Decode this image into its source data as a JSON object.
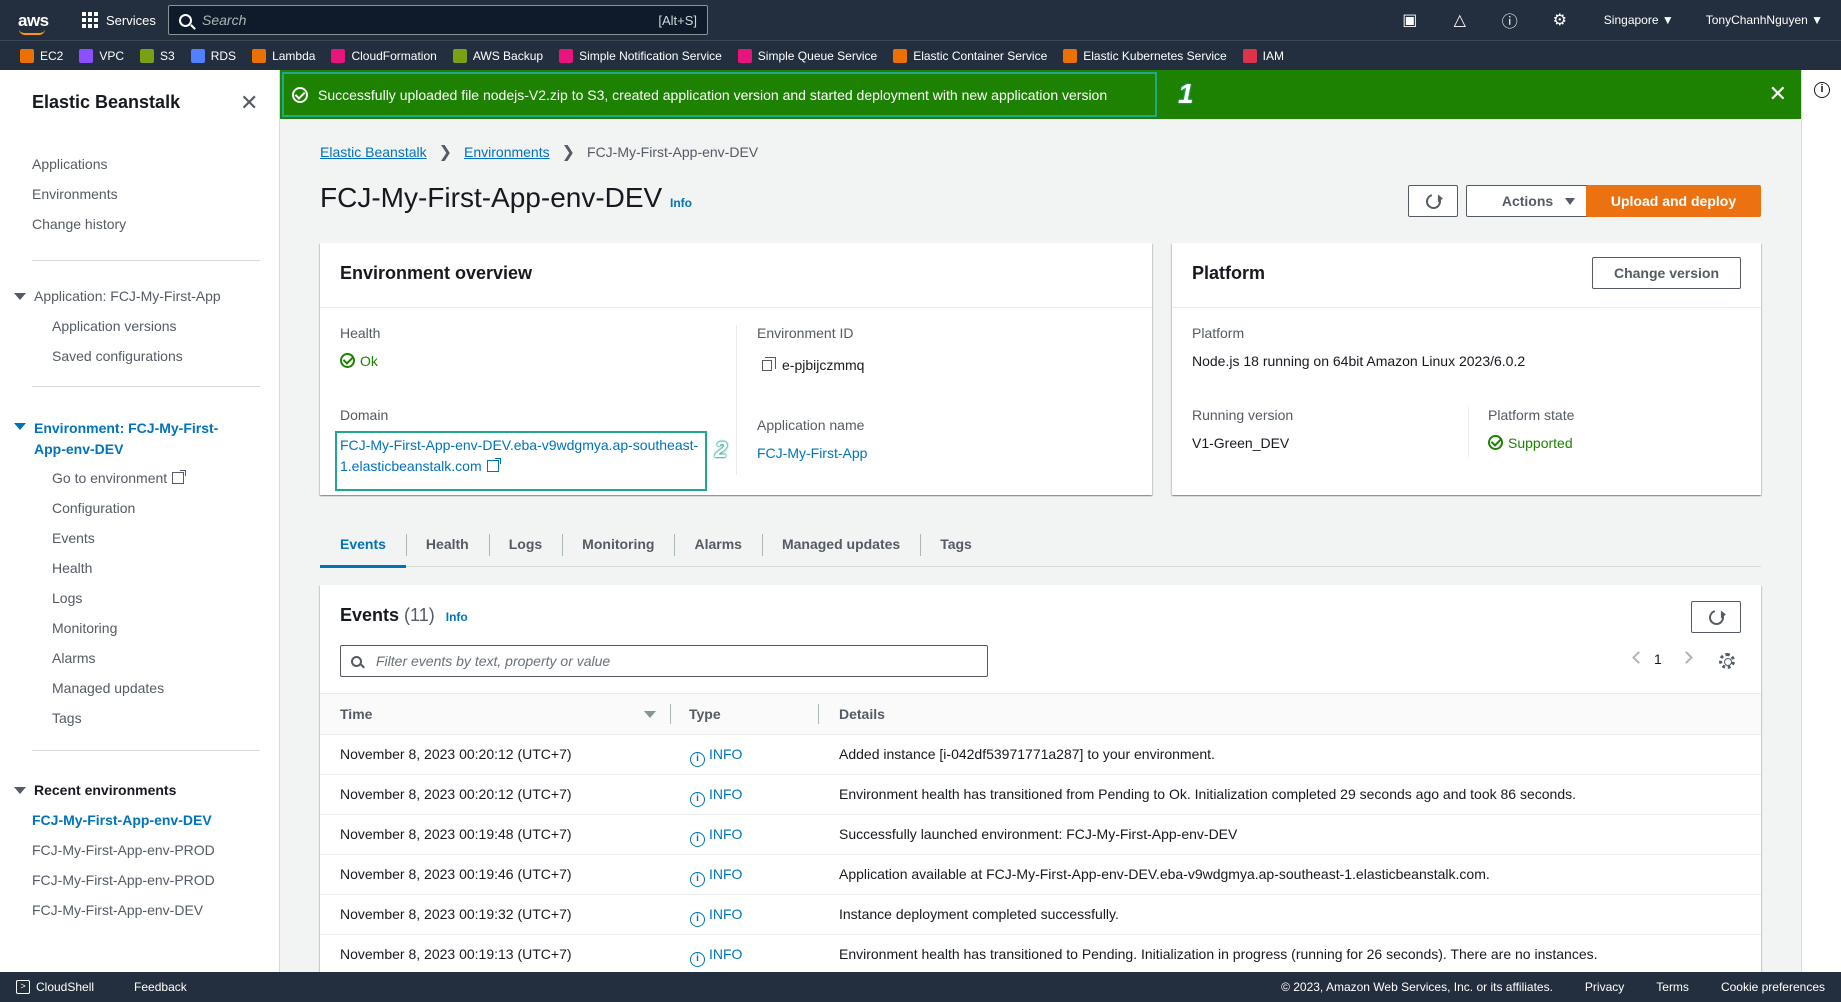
{
  "topnav": {
    "services_label": "Services",
    "search_placeholder": "Search",
    "search_shortcut": "[Alt+S]",
    "region": "Singapore ▼",
    "user": "TonyChanhNguyen ▼"
  },
  "favorites": [
    {
      "label": "EC2",
      "color": "#ed7100"
    },
    {
      "label": "VPC",
      "color": "#8c4fff"
    },
    {
      "label": "S3",
      "color": "#7aa116"
    },
    {
      "label": "RDS",
      "color": "#527fff"
    },
    {
      "label": "Lambda",
      "color": "#ed7100"
    },
    {
      "label": "CloudFormation",
      "color": "#e7157b"
    },
    {
      "label": "AWS Backup",
      "color": "#7aa116"
    },
    {
      "label": "Simple Notification Service",
      "color": "#e7157b"
    },
    {
      "label": "Simple Queue Service",
      "color": "#e7157b"
    },
    {
      "label": "Elastic Container Service",
      "color": "#ed7100"
    },
    {
      "label": "Elastic Kubernetes Service",
      "color": "#ed7100"
    },
    {
      "label": "IAM",
      "color": "#dd344c"
    }
  ],
  "sidebar": {
    "title": "Elastic Beanstalk",
    "top_items": [
      "Applications",
      "Environments",
      "Change history"
    ],
    "application_section": "Application: FCJ-My-First-App",
    "application_items": [
      "Application versions",
      "Saved configurations"
    ],
    "environment_section_line1": "Environment: FCJ-My-First-",
    "environment_section_line2": "App-env-DEV",
    "environment_items": [
      "Go to environment",
      "Configuration",
      "Events",
      "Health",
      "Logs",
      "Monitoring",
      "Alarms",
      "Managed updates",
      "Tags"
    ],
    "recent_section": "Recent environments",
    "recent_items": [
      "FCJ-My-First-App-env-DEV",
      "FCJ-My-First-App-env-PROD",
      "FCJ-My-First-App-env-PROD",
      "FCJ-My-First-App-env-DEV"
    ]
  },
  "flash": {
    "message": "Successfully uploaded file nodejs-V2.zip to S3, created application version and started deployment with new application version",
    "annotation": "1"
  },
  "breadcrumb": {
    "items": [
      "Elastic Beanstalk",
      "Environments"
    ],
    "current": "FCJ-My-First-App-env-DEV"
  },
  "page": {
    "title": "FCJ-My-First-App-env-DEV",
    "info": "Info",
    "actions": "Actions",
    "upload_deploy": "Upload and deploy"
  },
  "overview": {
    "title": "Environment overview",
    "health_label": "Health",
    "health_value": "Ok",
    "domain_label": "Domain",
    "domain_line1": "FCJ-My-First-App-env-DEV.eba-v9wdgmya.ap-southeast-",
    "domain_line2": "1.elasticbeanstalk.com",
    "domain_annotation": "2",
    "env_id_label": "Environment ID",
    "env_id_value": "e-pjbijczmmq",
    "app_name_label": "Application name",
    "app_name_value": "FCJ-My-First-App"
  },
  "platform": {
    "title": "Platform",
    "change_version": "Change version",
    "platform_label": "Platform",
    "platform_value": "Node.js 18 running on 64bit Amazon Linux 2023/6.0.2",
    "running_version_label": "Running version",
    "running_version_value": "V1-Green_DEV",
    "state_label": "Platform state",
    "state_value": "Supported"
  },
  "tabs": [
    "Events",
    "Health",
    "Logs",
    "Monitoring",
    "Alarms",
    "Managed updates",
    "Tags"
  ],
  "events": {
    "title": "Events",
    "count": "(11)",
    "info": "Info",
    "filter_placeholder": "Filter events by text, property or value",
    "page": "1",
    "columns": [
      "Time",
      "Type",
      "Details"
    ],
    "rows": [
      {
        "time": "November 8, 2023 00:20:12 (UTC+7)",
        "type": "INFO",
        "details": "Added instance [i-042df53971771a287] to your environment."
      },
      {
        "time": "November 8, 2023 00:20:12 (UTC+7)",
        "type": "INFO",
        "details": "Environment health has transitioned from Pending to Ok. Initialization completed 29 seconds ago and took 86 seconds."
      },
      {
        "time": "November 8, 2023 00:19:48 (UTC+7)",
        "type": "INFO",
        "details": "Successfully launched environment: FCJ-My-First-App-env-DEV"
      },
      {
        "time": "November 8, 2023 00:19:46 (UTC+7)",
        "type": "INFO",
        "details": "Application available at FCJ-My-First-App-env-DEV.eba-v9wdgmya.ap-southeast-1.elasticbeanstalk.com."
      },
      {
        "time": "November 8, 2023 00:19:32 (UTC+7)",
        "type": "INFO",
        "details": "Instance deployment completed successfully."
      },
      {
        "time": "November 8, 2023 00:19:13 (UTC+7)",
        "type": "INFO",
        "details": "Environment health has transitioned to Pending. Initialization in progress (running for 26 seconds). There are no instances."
      }
    ]
  },
  "footer": {
    "cloudshell": "CloudShell",
    "feedback": "Feedback",
    "copyright": "© 2023, Amazon Web Services, Inc. or its affiliates.",
    "privacy": "Privacy",
    "terms": "Terms",
    "cookies": "Cookie preferences"
  }
}
